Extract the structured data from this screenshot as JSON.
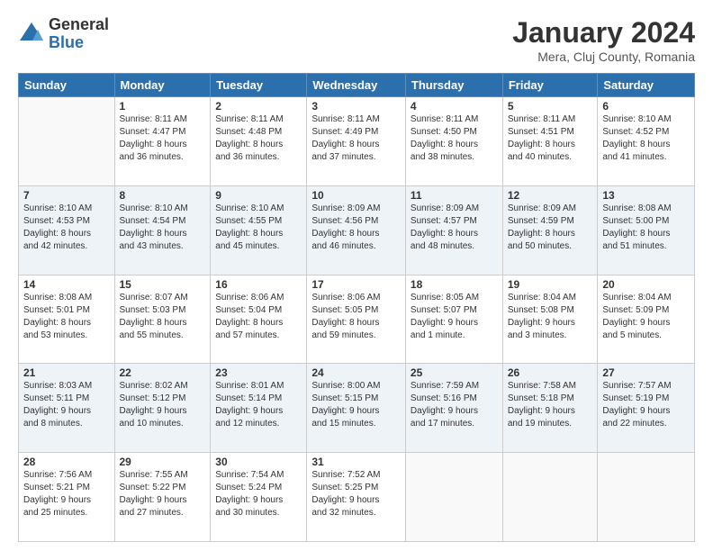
{
  "header": {
    "logo_general": "General",
    "logo_blue": "Blue",
    "month_title": "January 2024",
    "subtitle": "Mera, Cluj County, Romania"
  },
  "days_of_week": [
    "Sunday",
    "Monday",
    "Tuesday",
    "Wednesday",
    "Thursday",
    "Friday",
    "Saturday"
  ],
  "weeks": [
    [
      {
        "day": "",
        "info": ""
      },
      {
        "day": "1",
        "info": "Sunrise: 8:11 AM\nSunset: 4:47 PM\nDaylight: 8 hours\nand 36 minutes."
      },
      {
        "day": "2",
        "info": "Sunrise: 8:11 AM\nSunset: 4:48 PM\nDaylight: 8 hours\nand 36 minutes."
      },
      {
        "day": "3",
        "info": "Sunrise: 8:11 AM\nSunset: 4:49 PM\nDaylight: 8 hours\nand 37 minutes."
      },
      {
        "day": "4",
        "info": "Sunrise: 8:11 AM\nSunset: 4:50 PM\nDaylight: 8 hours\nand 38 minutes."
      },
      {
        "day": "5",
        "info": "Sunrise: 8:11 AM\nSunset: 4:51 PM\nDaylight: 8 hours\nand 40 minutes."
      },
      {
        "day": "6",
        "info": "Sunrise: 8:10 AM\nSunset: 4:52 PM\nDaylight: 8 hours\nand 41 minutes."
      }
    ],
    [
      {
        "day": "7",
        "info": "Sunrise: 8:10 AM\nSunset: 4:53 PM\nDaylight: 8 hours\nand 42 minutes."
      },
      {
        "day": "8",
        "info": "Sunrise: 8:10 AM\nSunset: 4:54 PM\nDaylight: 8 hours\nand 43 minutes."
      },
      {
        "day": "9",
        "info": "Sunrise: 8:10 AM\nSunset: 4:55 PM\nDaylight: 8 hours\nand 45 minutes."
      },
      {
        "day": "10",
        "info": "Sunrise: 8:09 AM\nSunset: 4:56 PM\nDaylight: 8 hours\nand 46 minutes."
      },
      {
        "day": "11",
        "info": "Sunrise: 8:09 AM\nSunset: 4:57 PM\nDaylight: 8 hours\nand 48 minutes."
      },
      {
        "day": "12",
        "info": "Sunrise: 8:09 AM\nSunset: 4:59 PM\nDaylight: 8 hours\nand 50 minutes."
      },
      {
        "day": "13",
        "info": "Sunrise: 8:08 AM\nSunset: 5:00 PM\nDaylight: 8 hours\nand 51 minutes."
      }
    ],
    [
      {
        "day": "14",
        "info": "Sunrise: 8:08 AM\nSunset: 5:01 PM\nDaylight: 8 hours\nand 53 minutes."
      },
      {
        "day": "15",
        "info": "Sunrise: 8:07 AM\nSunset: 5:03 PM\nDaylight: 8 hours\nand 55 minutes."
      },
      {
        "day": "16",
        "info": "Sunrise: 8:06 AM\nSunset: 5:04 PM\nDaylight: 8 hours\nand 57 minutes."
      },
      {
        "day": "17",
        "info": "Sunrise: 8:06 AM\nSunset: 5:05 PM\nDaylight: 8 hours\nand 59 minutes."
      },
      {
        "day": "18",
        "info": "Sunrise: 8:05 AM\nSunset: 5:07 PM\nDaylight: 9 hours\nand 1 minute."
      },
      {
        "day": "19",
        "info": "Sunrise: 8:04 AM\nSunset: 5:08 PM\nDaylight: 9 hours\nand 3 minutes."
      },
      {
        "day": "20",
        "info": "Sunrise: 8:04 AM\nSunset: 5:09 PM\nDaylight: 9 hours\nand 5 minutes."
      }
    ],
    [
      {
        "day": "21",
        "info": "Sunrise: 8:03 AM\nSunset: 5:11 PM\nDaylight: 9 hours\nand 8 minutes."
      },
      {
        "day": "22",
        "info": "Sunrise: 8:02 AM\nSunset: 5:12 PM\nDaylight: 9 hours\nand 10 minutes."
      },
      {
        "day": "23",
        "info": "Sunrise: 8:01 AM\nSunset: 5:14 PM\nDaylight: 9 hours\nand 12 minutes."
      },
      {
        "day": "24",
        "info": "Sunrise: 8:00 AM\nSunset: 5:15 PM\nDaylight: 9 hours\nand 15 minutes."
      },
      {
        "day": "25",
        "info": "Sunrise: 7:59 AM\nSunset: 5:16 PM\nDaylight: 9 hours\nand 17 minutes."
      },
      {
        "day": "26",
        "info": "Sunrise: 7:58 AM\nSunset: 5:18 PM\nDaylight: 9 hours\nand 19 minutes."
      },
      {
        "day": "27",
        "info": "Sunrise: 7:57 AM\nSunset: 5:19 PM\nDaylight: 9 hours\nand 22 minutes."
      }
    ],
    [
      {
        "day": "28",
        "info": "Sunrise: 7:56 AM\nSunset: 5:21 PM\nDaylight: 9 hours\nand 25 minutes."
      },
      {
        "day": "29",
        "info": "Sunrise: 7:55 AM\nSunset: 5:22 PM\nDaylight: 9 hours\nand 27 minutes."
      },
      {
        "day": "30",
        "info": "Sunrise: 7:54 AM\nSunset: 5:24 PM\nDaylight: 9 hours\nand 30 minutes."
      },
      {
        "day": "31",
        "info": "Sunrise: 7:52 AM\nSunset: 5:25 PM\nDaylight: 9 hours\nand 32 minutes."
      },
      {
        "day": "",
        "info": ""
      },
      {
        "day": "",
        "info": ""
      },
      {
        "day": "",
        "info": ""
      }
    ]
  ]
}
